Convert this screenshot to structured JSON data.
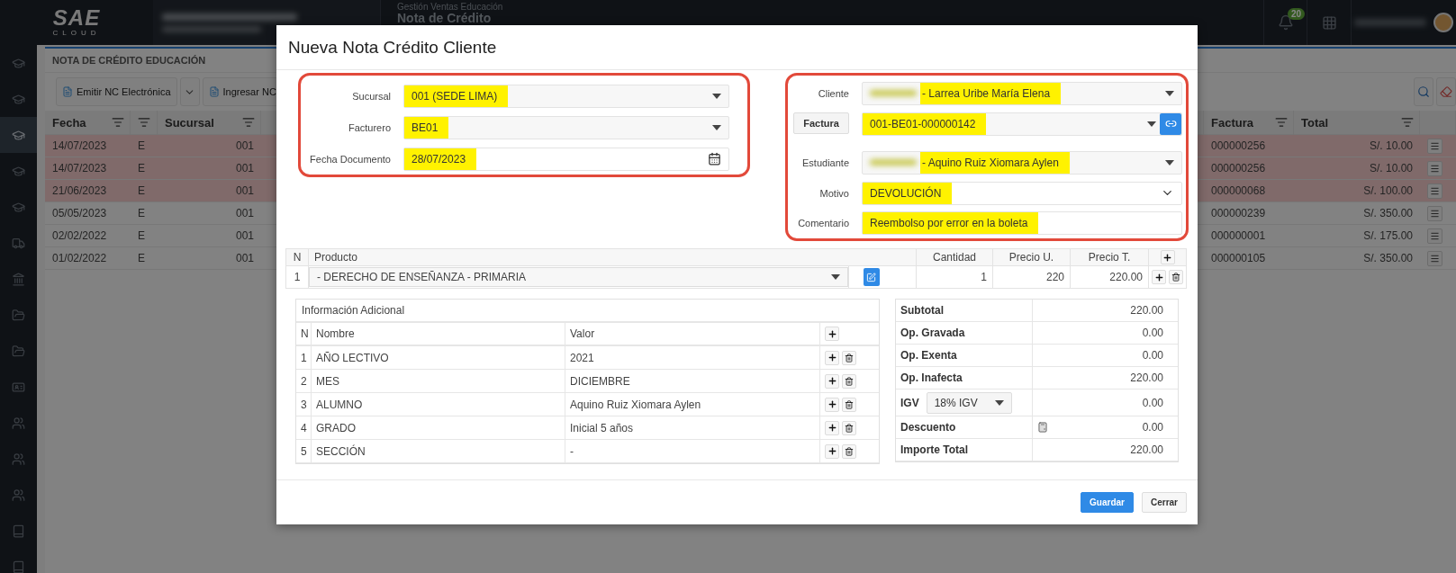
{
  "header": {
    "logo": "SAE",
    "logo_sub": "CLOUD",
    "module": "Gestión Ventas Educación",
    "page": "Nota de Crédito",
    "notifications": "20"
  },
  "sidebar": {
    "items": [
      {
        "kind": "cap",
        "selected": false
      },
      {
        "kind": "cap",
        "selected": false
      },
      {
        "kind": "cap",
        "selected": true
      },
      {
        "kind": "cap",
        "selected": false
      },
      {
        "kind": "cap",
        "selected": false
      },
      {
        "kind": "truck",
        "selected": false
      },
      {
        "kind": "bank",
        "selected": false
      },
      {
        "kind": "folder",
        "selected": false
      },
      {
        "kind": "folder",
        "selected": false
      },
      {
        "kind": "card",
        "selected": false
      },
      {
        "kind": "users",
        "selected": false
      },
      {
        "kind": "users",
        "selected": false
      },
      {
        "kind": "users",
        "selected": false
      },
      {
        "kind": "book",
        "selected": false
      },
      {
        "kind": "book",
        "selected": false
      }
    ]
  },
  "panel": {
    "title": "NOTA DE CRÉDITO EDUCACIÓN",
    "toolbar": [
      "Emitir NC Electrónica",
      "Ingresar NC"
    ],
    "columns": {
      "date": "Fecha",
      "branch": "Sucursal",
      "invoice": "Factura",
      "total": "Total"
    },
    "rows": [
      {
        "date": "14/07/2023",
        "type": "E",
        "branch": "001",
        "invoice": "000000256",
        "total": "S/. 10.00",
        "highlighted": true
      },
      {
        "date": "14/07/2023",
        "type": "E",
        "branch": "001",
        "invoice": "000000256",
        "total": "S/. 10.00",
        "highlighted": true
      },
      {
        "date": "21/06/2023",
        "type": "E",
        "branch": "001",
        "invoice": "000000068",
        "total": "S/. 100.00",
        "highlighted": true
      },
      {
        "date": "05/05/2023",
        "type": "E",
        "branch": "001",
        "invoice": "000000239",
        "total": "S/. 350.00",
        "highlighted": false
      },
      {
        "date": "02/02/2022",
        "type": "E",
        "branch": "001",
        "invoice": "000000001",
        "total": "S/. 175.00",
        "highlighted": false
      },
      {
        "date": "01/02/2022",
        "type": "E",
        "branch": "001",
        "invoice": "000000105",
        "total": "S/. 350.00",
        "highlighted": false
      }
    ]
  },
  "modal": {
    "title": "Nueva Nota Crédito Cliente",
    "left_fields": [
      {
        "label": "Sucursal",
        "value": "001 (SEDE LIMA)",
        "kind": "select",
        "highlighted": true
      },
      {
        "label": "Facturero",
        "value": "BE01",
        "kind": "select",
        "highlighted": true
      },
      {
        "label": "Fecha Documento",
        "value": "28/07/2023",
        "kind": "date",
        "highlighted": true
      }
    ],
    "right_fields": [
      {
        "label": "Cliente",
        "value": "- Larrea Uribe María Elena",
        "kind": "select",
        "redacted": true,
        "highlighted": true
      },
      {
        "label": "Factura",
        "value": "001-BE01-000000142",
        "kind": "invoice",
        "redacted": false,
        "highlighted": true
      },
      {
        "label": "Estudiante",
        "value": "- Aquino Ruiz Xiomara Aylen",
        "kind": "select",
        "redacted": true,
        "highlighted": true
      },
      {
        "label": "Motivo",
        "value": "DEVOLUCIÓN",
        "kind": "chevron",
        "redacted": false,
        "highlighted": true
      },
      {
        "label": "Comentario",
        "value": "Reembolso por error en la boleta",
        "kind": "text",
        "redacted": false,
        "highlighted": true
      }
    ],
    "products": {
      "columns": [
        "N",
        "Producto",
        "Cantidad",
        "Precio U.",
        "Precio T."
      ],
      "rows": [
        {
          "n": "1",
          "product": "- DERECHO DE ENSEÑANZA - PRIMARIA",
          "quantity": "1",
          "unit_price": "220",
          "total_price": "220.00"
        }
      ]
    },
    "info": {
      "title": "Información Adicional",
      "columns": [
        "N",
        "Nombre",
        "Valor"
      ],
      "rows": [
        {
          "n": "1",
          "name": "AÑO LECTIVO",
          "value": "2021"
        },
        {
          "n": "2",
          "name": "MES",
          "value": "DICIEMBRE"
        },
        {
          "n": "3",
          "name": "ALUMNO",
          "value": "Aquino Ruiz Xiomara Aylen"
        },
        {
          "n": "4",
          "name": "GRADO",
          "value": "Inicial 5 años"
        },
        {
          "n": "5",
          "name": "SECCIÓN",
          "value": "-"
        }
      ]
    },
    "summary": [
      {
        "label": "Subtotal",
        "value": "220.00",
        "kind": "plain"
      },
      {
        "label": "Op. Gravada",
        "value": "0.00",
        "kind": "plain"
      },
      {
        "label": "Op. Exenta",
        "value": "0.00",
        "kind": "plain"
      },
      {
        "label": "Op. Inafecta",
        "value": "220.00",
        "kind": "plain"
      },
      {
        "label": "IGV",
        "value": "0.00",
        "kind": "select",
        "option": "18% IGV"
      },
      {
        "label": "Descuento",
        "value": "0.00",
        "kind": "calculator"
      },
      {
        "label": "Importe Total",
        "value": "220.00",
        "kind": "plain"
      }
    ],
    "buttons": [
      {
        "label": "Guardar",
        "kind": "primary"
      },
      {
        "label": "Cerrar",
        "kind": "default"
      }
    ]
  }
}
